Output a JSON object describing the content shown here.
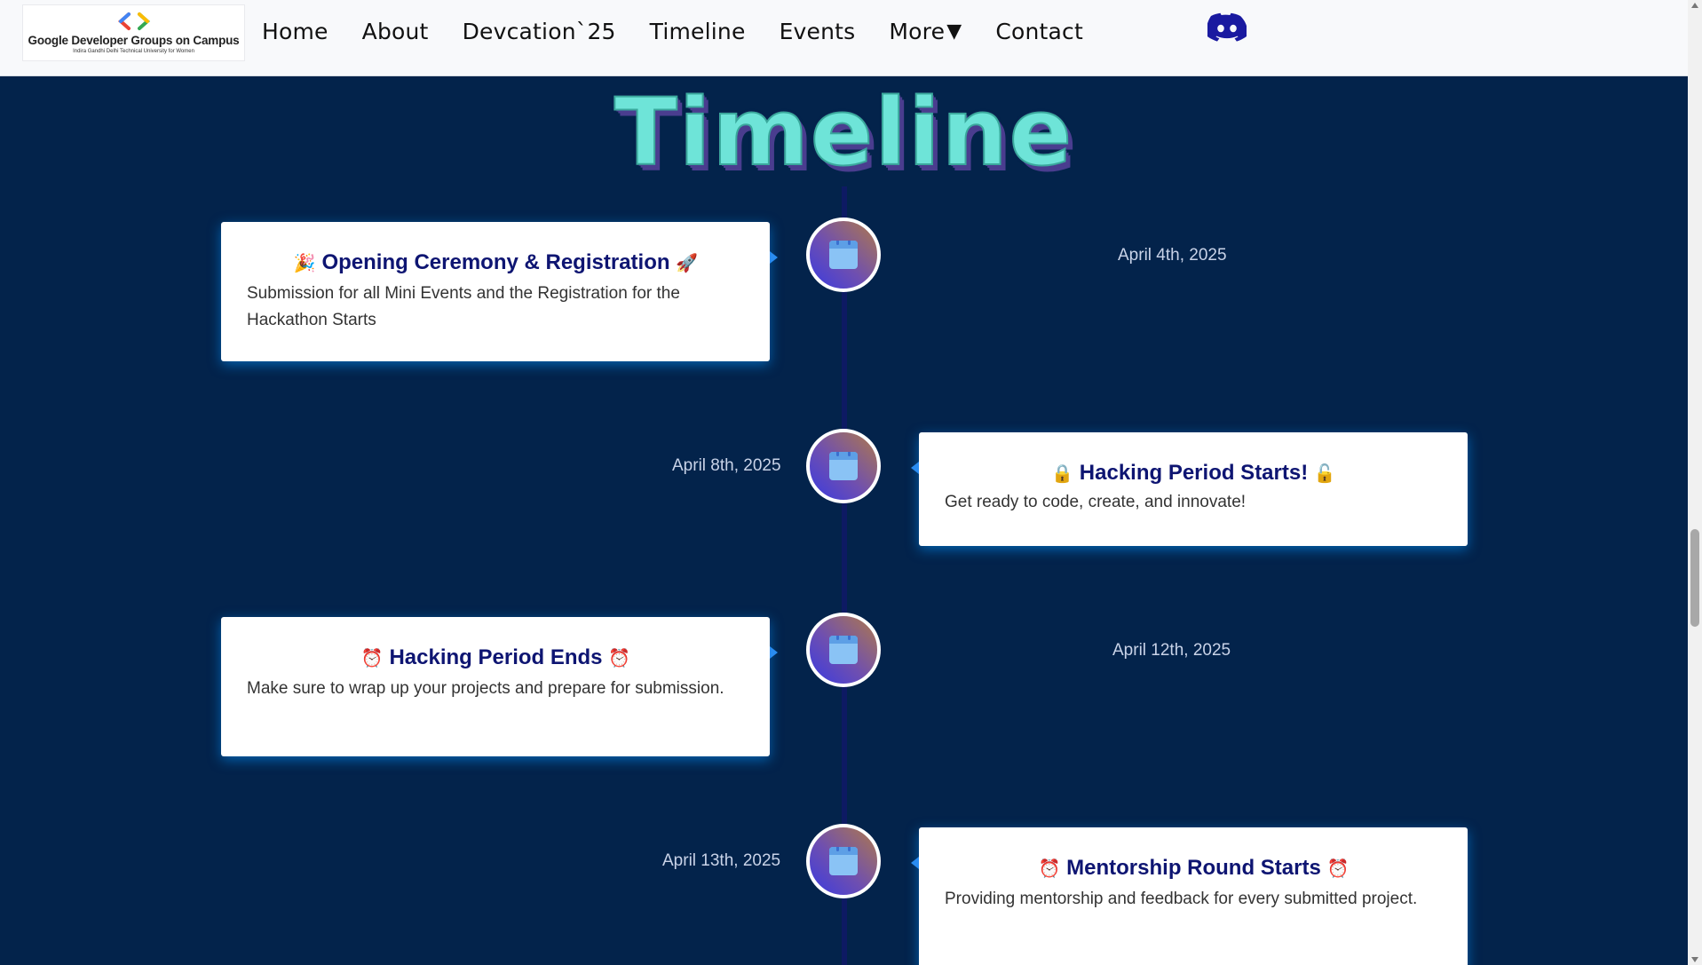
{
  "logo": {
    "title": "Google Developer Groups on Campus",
    "subtitle": "Indira Gandhi Delhi Technical University for Women"
  },
  "nav": {
    "items": [
      "Home",
      "About",
      "Devcation`25",
      "Timeline",
      "Events",
      "More",
      "Contact"
    ],
    "more_caret": "▼",
    "discord_icon": "discord-icon"
  },
  "heading": "Timeline",
  "timeline": [
    {
      "date": "April 4th, 2025",
      "emoji_left": "🎉",
      "title": "Opening Ceremony & Registration",
      "emoji_right": "🚀",
      "description": "Submission for all Mini Events and the Registration for the Hackathon Starts"
    },
    {
      "date": "April 8th, 2025",
      "emoji_left": "🔒",
      "title": "Hacking Period Starts!",
      "emoji_right": "🔓",
      "description": "Get ready to code, create, and innovate!"
    },
    {
      "date": "April 12th, 2025",
      "emoji_left": "⏰",
      "title": "Hacking Period Ends",
      "emoji_right": "⏰",
      "description": "Make sure to wrap up your projects and prepare for submission."
    },
    {
      "date": "April 13th, 2025",
      "emoji_left": "⏰",
      "title": "Mentorship Round Starts",
      "emoji_right": "⏰",
      "description": "Providing mentorship and feedback for every submitted project."
    }
  ],
  "colors": {
    "background": "#03234b",
    "heading": "#6ee4d8",
    "card_title": "#0e1572",
    "axis": "#0d1a63"
  }
}
